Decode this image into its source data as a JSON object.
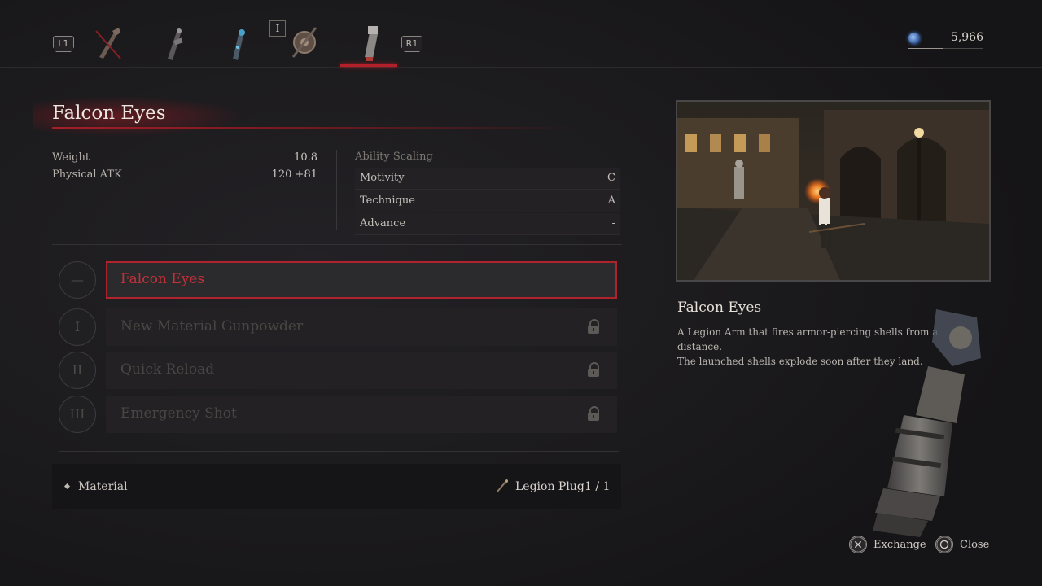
{
  "topbar": {
    "left_shoulder": "L1",
    "right_shoulder": "R1",
    "slot_tag": "I",
    "arms": [
      {
        "icon": "legion-arm-crossed-icon"
      },
      {
        "icon": "legion-arm-flamberge-icon"
      },
      {
        "icon": "legion-arm-blue-icon"
      },
      {
        "icon": "legion-arm-shield-icon"
      },
      {
        "icon": "legion-arm-falcon-eyes-icon",
        "selected": true
      }
    ],
    "currency": {
      "icon": "ergo-icon",
      "value": "5,966"
    }
  },
  "item": {
    "name": "Falcon Eyes",
    "stats": [
      {
        "label": "Weight",
        "value": "10.8"
      },
      {
        "label": "Physical ATK",
        "value": "120 +81"
      }
    ],
    "scaling_label": "Ability Scaling",
    "scaling": [
      {
        "label": "Motivity",
        "grade": "C"
      },
      {
        "label": "Technique",
        "grade": "A"
      },
      {
        "label": "Advance",
        "grade": "-"
      }
    ]
  },
  "skills": [
    {
      "numeral": "—",
      "label": "Falcon Eyes",
      "active": true,
      "locked": false
    },
    {
      "numeral": "I",
      "label": "New Material Gunpowder",
      "active": false,
      "locked": true
    },
    {
      "numeral": "II",
      "label": "Quick Reload",
      "active": false,
      "locked": true
    },
    {
      "numeral": "III",
      "label": "Emergency Shot",
      "active": false,
      "locked": true
    }
  ],
  "material": {
    "label": "Material",
    "item_icon": "legion-plug-icon",
    "item_name": "Legion Plug",
    "count": "1 / 1"
  },
  "detail": {
    "title": "Falcon Eyes",
    "description_line1": "A Legion Arm that fires armor-piercing shells from a distance.",
    "description_line2": "The launched shells explode soon after they land."
  },
  "prompts": [
    {
      "icon": "cross-button-icon",
      "label": "Exchange"
    },
    {
      "icon": "circle-button-icon",
      "label": "Close"
    }
  ],
  "colors": {
    "accent": "#b0232c",
    "background": "#1b1a1c"
  }
}
